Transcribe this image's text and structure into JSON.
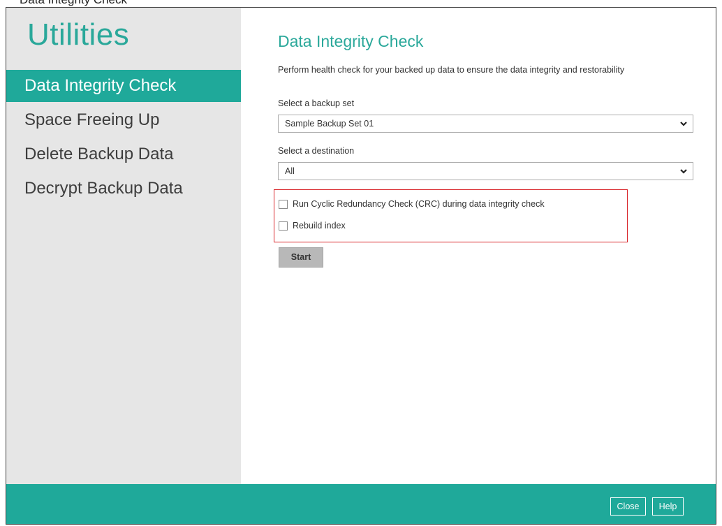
{
  "caption_fragment": "Data Integrity Check",
  "app": {
    "title": "Utilities"
  },
  "sidebar": {
    "items": [
      {
        "label": "Data Integrity Check",
        "active": true
      },
      {
        "label": "Space Freeing Up",
        "active": false
      },
      {
        "label": "Delete Backup Data",
        "active": false
      },
      {
        "label": "Decrypt Backup Data",
        "active": false
      }
    ]
  },
  "main": {
    "title": "Data Integrity Check",
    "description": "Perform health check for your backed up data to ensure the data integrity and restorability",
    "backup_set": {
      "label": "Select a backup set",
      "value": "Sample Backup Set 01"
    },
    "destination": {
      "label": "Select a destination",
      "value": "All"
    },
    "options": [
      {
        "label": "Run Cyclic Redundancy Check (CRC) during data integrity check",
        "checked": false
      },
      {
        "label": "Rebuild index",
        "checked": false
      }
    ],
    "start_label": "Start"
  },
  "footer": {
    "close_label": "Close",
    "help_label": "Help"
  },
  "colors": {
    "accent": "#1fa99a",
    "title_teal": "#2aa89a",
    "sidebar_bg": "#e6e6e6",
    "highlight_border": "#d9262b"
  },
  "icons": {
    "dropdown": "chevron-down-icon"
  }
}
